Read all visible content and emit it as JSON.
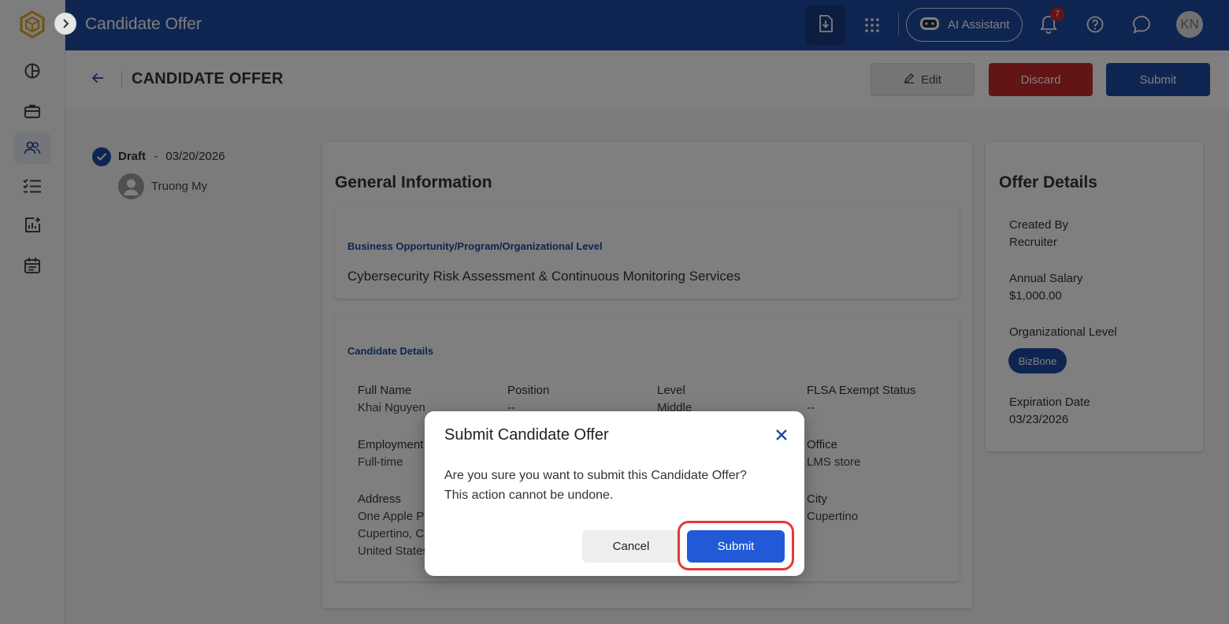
{
  "app": {
    "title": "Candidate Offer"
  },
  "topbar": {
    "ai_assistant_label": "AI Assistant",
    "notification_count": "7",
    "user_initials": "KN"
  },
  "header": {
    "page_title": "CANDIDATE OFFER",
    "edit_label": "Edit",
    "discard_label": "Discard",
    "submit_label": "Submit"
  },
  "timeline": {
    "status": "Draft",
    "separator": "-",
    "date": "03/20/2026",
    "user": "Truong My"
  },
  "general": {
    "heading": "General Information",
    "opportunity": {
      "label": "Business Opportunity/Program/Organizational Level",
      "value": "Cybersecurity Risk Assessment & Continuous Monitoring Services"
    },
    "candidate": {
      "label": "Candidate Details",
      "full_name": {
        "k": "Full Name",
        "v": "Khai Nguyen"
      },
      "position": {
        "k": "Position",
        "v": "--"
      },
      "level": {
        "k": "Level",
        "v": "Middle"
      },
      "flsa": {
        "k": "FLSA Exempt Status",
        "v": "--"
      },
      "employment": {
        "k": "Employment",
        "v": "Full-time"
      },
      "office": {
        "k": "Office",
        "v": "LMS store"
      },
      "address": {
        "k": "Address",
        "line1": "One Apple Pa",
        "line2": "Cupertino, CA",
        "line3": "United States"
      },
      "city": {
        "k": "City",
        "v": "Cupertino"
      }
    }
  },
  "offer": {
    "heading": "Offer Details",
    "created_by": {
      "k": "Created By",
      "v": "Recruiter"
    },
    "salary": {
      "k": "Annual Salary",
      "v": "$1,000.00"
    },
    "org_level": {
      "k": "Organizational Level",
      "chip": "BizBone"
    },
    "expiration": {
      "k": "Expiration Date",
      "v": "03/23/2026"
    }
  },
  "dialog": {
    "title": "Submit Candidate Offer",
    "message_line1": "Are you sure you want to submit this Candidate Offer?",
    "message_line2": "This action cannot be undone.",
    "cancel_label": "Cancel",
    "submit_label": "Submit"
  },
  "colors": {
    "primary": "#1f4aa3",
    "danger": "#c62828",
    "dialog_submit": "#2259d6",
    "highlight": "#e53935"
  },
  "icons": [
    "logo-icon",
    "chevron-right-icon",
    "dashboard-icon",
    "briefcase-icon",
    "people-icon",
    "checklist-icon",
    "report-icon",
    "calendar-icon",
    "download-icon",
    "apps-grid-icon",
    "robot-icon",
    "bell-icon",
    "help-icon",
    "chat-icon",
    "arrow-left-icon",
    "pencil-icon",
    "check-icon",
    "user-icon",
    "close-icon"
  ]
}
